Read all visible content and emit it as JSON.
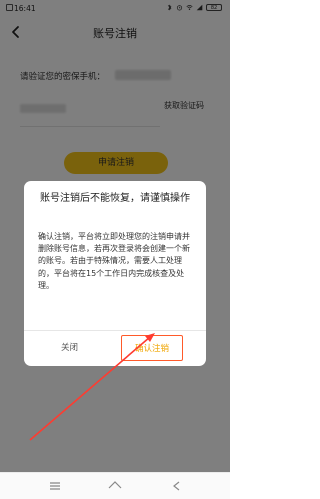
{
  "status_bar": {
    "time": "16:41",
    "battery": "82"
  },
  "header": {
    "title": "账号注销"
  },
  "form": {
    "phone_label": "请验证您的密保手机：",
    "get_code_label": "获取验证码",
    "apply_button_label": "申请注销"
  },
  "dialog": {
    "title": "账号注销后不能恢复，请谨慎操作",
    "body": "确认注销，平台将立即处理您的注销申请并删除账号信息，若再次登录将会创建一个新的账号。若由于特殊情况，需要人工处理的，平台将在15个工作日内完成核查及处理。",
    "cancel_label": "关闭",
    "confirm_label": "确认注销"
  },
  "colors": {
    "accent": "#f5c518",
    "confirm_text": "#f0a500",
    "annotation_red": "#ff3b30"
  }
}
